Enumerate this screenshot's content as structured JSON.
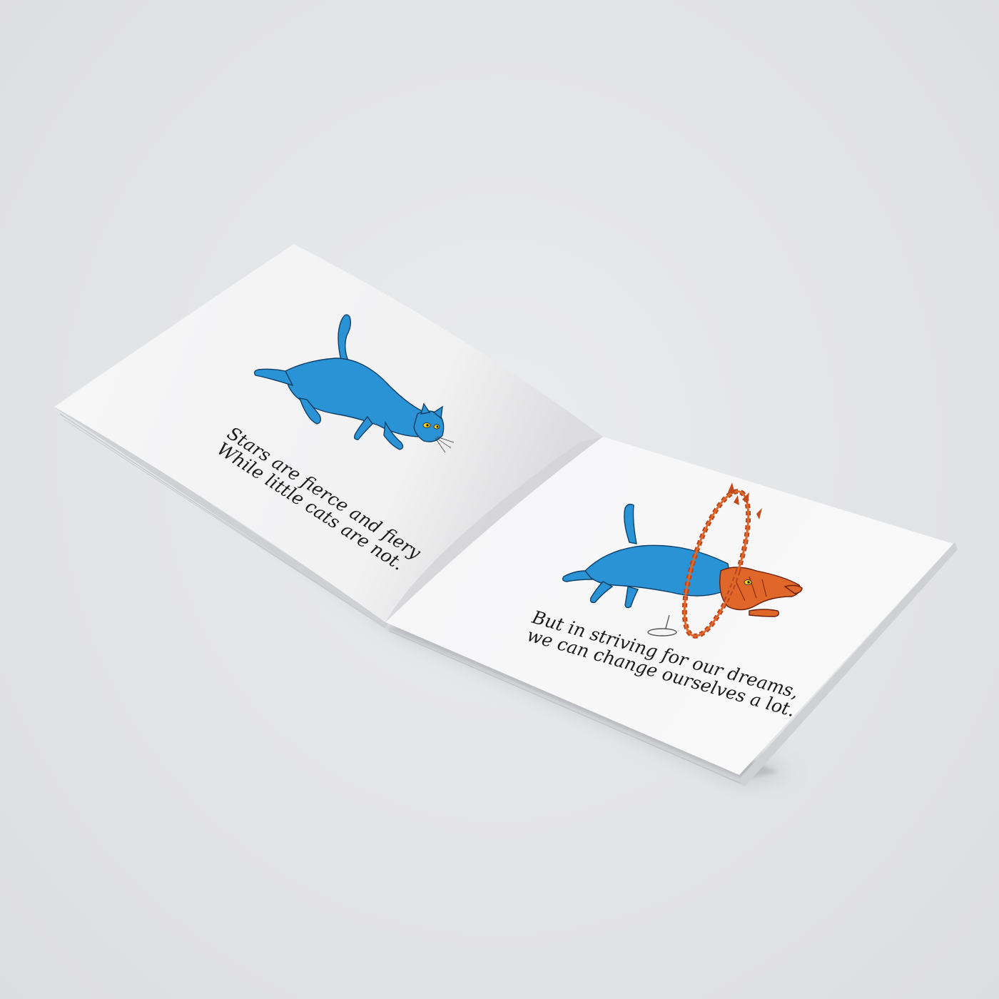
{
  "book": {
    "left_page": {
      "caption_lines": [
        "Stars are fierce and fiery",
        "While little cats are not."
      ],
      "illustration": "blue-cat-stretching"
    },
    "right_page": {
      "caption_lines": [
        "But in striving for our dreams,",
        "we can change ourselves a lot."
      ],
      "illustration": "blue-cat-jumping-through-fire-hoop"
    }
  },
  "colors": {
    "background": "#e2e3e5",
    "page": "#f4f4f5",
    "cat_blue": "#2a93d5",
    "cat_orange": "#e0672a",
    "fire": "#b8441b"
  }
}
